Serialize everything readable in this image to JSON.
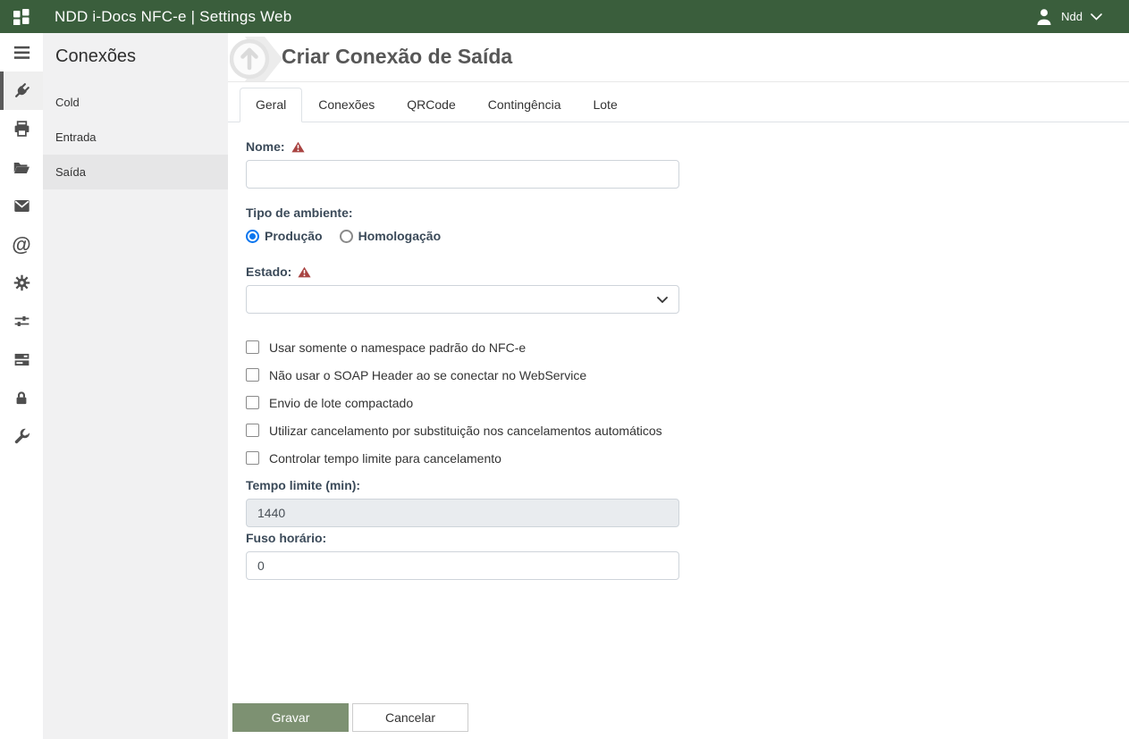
{
  "header": {
    "title": "NDD i-Docs NFC-e | Settings Web",
    "user_name": "Ndd"
  },
  "icon_rail": {
    "items": [
      {
        "id": "menu",
        "icon": "hamburger-icon",
        "active": false
      },
      {
        "id": "connections",
        "icon": "plug-icon",
        "active": true
      },
      {
        "id": "printers",
        "icon": "printer-icon",
        "active": false
      },
      {
        "id": "folders",
        "icon": "folder-open-icon",
        "active": false
      },
      {
        "id": "mail",
        "icon": "envelope-icon",
        "active": false
      },
      {
        "id": "email-at",
        "icon": "at-sign-icon",
        "active": false
      },
      {
        "id": "settings",
        "icon": "gear-icon",
        "active": false
      },
      {
        "id": "preferences",
        "icon": "sliders-icon",
        "active": false
      },
      {
        "id": "servers",
        "icon": "server-icon",
        "active": false
      },
      {
        "id": "security",
        "icon": "lock-icon",
        "active": false
      },
      {
        "id": "tools",
        "icon": "wrench-icon",
        "active": false
      }
    ],
    "at_glyph": "@"
  },
  "sidebar": {
    "title": "Conexões",
    "items": [
      {
        "label": "Cold",
        "selected": false
      },
      {
        "label": "Entrada",
        "selected": false
      },
      {
        "label": "Saída",
        "selected": true
      }
    ]
  },
  "main": {
    "page_title": "Criar Conexão de Saída",
    "tabs": [
      {
        "label": "Geral",
        "active": true
      },
      {
        "label": "Conexões",
        "active": false
      },
      {
        "label": "QRCode",
        "active": false
      },
      {
        "label": "Contingência",
        "active": false
      },
      {
        "label": "Lote",
        "active": false
      }
    ],
    "form": {
      "nome": {
        "label": "Nome:",
        "value": "",
        "required": true
      },
      "tipo_ambiente": {
        "label": "Tipo de ambiente:",
        "options": [
          {
            "label": "Produção",
            "selected": true
          },
          {
            "label": "Homologação",
            "selected": false
          }
        ]
      },
      "estado": {
        "label": "Estado:",
        "value": "",
        "required": true
      },
      "checkboxes": [
        {
          "label": "Usar somente o namespace padrão do NFC-e",
          "checked": false
        },
        {
          "label": "Não usar o SOAP Header ao se conectar no WebService",
          "checked": false
        },
        {
          "label": "Envio de lote compactado",
          "checked": false
        },
        {
          "label": "Utilizar cancelamento por substituição nos cancelamentos automáticos",
          "checked": false
        },
        {
          "label": "Controlar tempo limite para cancelamento",
          "checked": false
        }
      ],
      "tempo_limite": {
        "label": "Tempo limite (min):",
        "value": "1440",
        "disabled": true
      },
      "fuso_horario": {
        "label": "Fuso horário:",
        "value": "0",
        "disabled": false
      }
    },
    "actions": {
      "save_label": "Gravar",
      "cancel_label": "Cancelar"
    }
  },
  "colors": {
    "header_green": "#3a5e3c",
    "save_button_green": "#7d9172",
    "required_warning_red": "#a94442",
    "radio_selected_blue": "#0b76ef",
    "sidebar_bg": "#f1f1f2",
    "sidebar_selected_bg": "#e6e6e7"
  }
}
